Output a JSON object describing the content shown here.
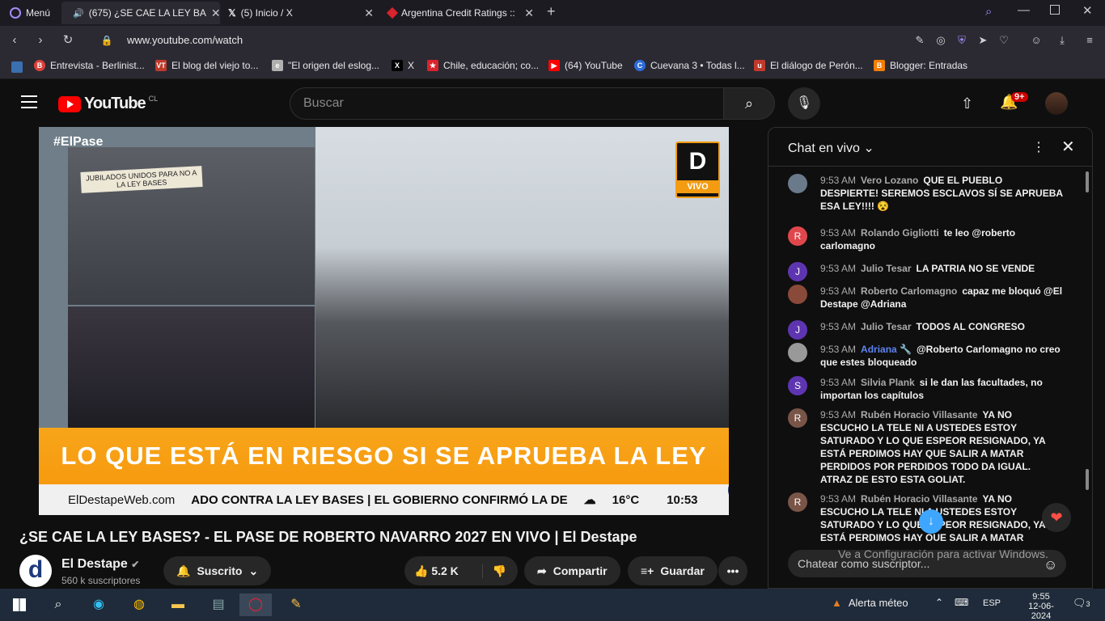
{
  "browser": {
    "menu_label": "Menú",
    "tabs": [
      {
        "title": "(675) ¿SE CAE LA LEY BA",
        "active": true
      },
      {
        "title": "(5) Inicio / X",
        "active": false
      },
      {
        "title": "Argentina Credit Ratings ::",
        "active": false
      }
    ],
    "url": "www.youtube.com/watch",
    "bookmarks": [
      {
        "label": "Entrevista - Berlinist...",
        "icon": "B",
        "color": "#d9413b"
      },
      {
        "label": "El blog del viejo to...",
        "icon": "VT",
        "color": "#c0392b"
      },
      {
        "label": "\"El origen del eslog...",
        "icon": "e",
        "color": "#b0b0b0"
      },
      {
        "label": "X",
        "icon": "X",
        "color": "#000000"
      },
      {
        "label": "Chile, educación; co...",
        "icon": "★",
        "color": "#d9232d"
      },
      {
        "label": "(64) YouTube",
        "icon": "▶",
        "color": "#ff0000"
      },
      {
        "label": "Cuevana 3 • Todas l...",
        "icon": "C",
        "color": "#2d6bd8"
      },
      {
        "label": "El diálogo de Perón...",
        "icon": "u",
        "color": "#c0392b"
      },
      {
        "label": "Blogger: Entradas",
        "icon": "B",
        "color": "#f57d00"
      }
    ]
  },
  "youtube": {
    "logo_text": "YouTube",
    "country": "CL",
    "search_placeholder": "Buscar",
    "notif_count": "9+"
  },
  "video": {
    "overlay_brand": "#ElPase",
    "sign_text": "JUBILADOS UNIDOS PARA NO A LA LEY BASES",
    "live_logo": "D",
    "live_label": "VIVO",
    "banner_text": "LO QUE ESTÁ EN RIESGO SI SE APRUEBA LA LEY",
    "ticker_site": "ElDestapeWeb.com",
    "ticker_text": "ADO CONTRA LA LEY BASES  |  EL GOBIERNO CONFIRMÓ LA DE",
    "temp": "16°C",
    "time": "10:53",
    "title": "¿SE CAE LA LEY BASES? - EL PASE DE ROBERTO NAVARRO 2027 EN VIVO | El Destape"
  },
  "channel": {
    "name": "El Destape",
    "subs": "560 k suscriptores",
    "subscribed_label": "Suscrito",
    "likes": "5.2 K",
    "share_label": "Compartir",
    "save_label": "Guardar"
  },
  "chat": {
    "title": "Chat en vivo",
    "messages": [
      {
        "time": "9:53 AM",
        "author": "Vero Lozano",
        "text": "QUE EL PUEBLO DESPIERTE! SEREMOS ESCLAVOS SÍ SE APRUEBA ESA LEY!!!! 😵",
        "avatar": "",
        "color": "#6b7a8a"
      },
      {
        "time": "9:53 AM",
        "author": "Rolando Gigliotti",
        "text": "te leo @roberto carlomagno",
        "avatar": "R",
        "color": "#e0474c"
      },
      {
        "time": "9:53 AM",
        "author": "Julio Tesar",
        "text": "LA PATRIA NO SE VENDE",
        "avatar": "J",
        "color": "#5e35b1"
      },
      {
        "time": "9:53 AM",
        "author": "Roberto Carlomagno",
        "text": "capaz me bloquó @El Destape @Adriana",
        "avatar": "",
        "color": "#8a4a3a"
      },
      {
        "time": "9:53 AM",
        "author": "Julio Tesar",
        "text": "TODOS AL CONGRESO",
        "avatar": "J",
        "color": "#5e35b1"
      },
      {
        "time": "9:53 AM",
        "author": "Adriana 🔧",
        "text": "@Roberto Carlomagno no creo que estes bloqueado",
        "avatar": "",
        "color": "#999999"
      },
      {
        "time": "9:53 AM",
        "author": "Silvia Plank",
        "text": "si le dan las facultades, no importan los capítulos",
        "avatar": "S",
        "color": "#5e35b1"
      },
      {
        "time": "9:53 AM",
        "author": "Rubén Horacio Villasante",
        "text": "YA NO ESCUCHO LA TELE NI A USTEDES ESTOY SATURADO Y LO QUE ESPEOR RESIGNADO, YA ESTÁ PERDIMOS HAY QUE SALIR A MATAR PERDIDOS POR PERDIDOS TODO DA IGUAL. ATRAZ DE ESTO ESTA GOLIAT.",
        "avatar": "R",
        "color": "#795548"
      },
      {
        "time": "9:53 AM",
        "author": "Rubén Horacio Villasante",
        "text": "YA NO ESCUCHO LA TELE NI A USTEDES ESTOY SATURADO Y LO QUE ESPEOR RESIGNADO, YA ESTÁ PERDIMOS HAY QUE SALIR A MATAR",
        "avatar": "R",
        "color": "#795548"
      }
    ],
    "input_placeholder": "Chatear como suscriptor..."
  },
  "windows": {
    "watermark": "Ve a Configuración para activar Windows.",
    "weather": "Alerta méteo",
    "lang": "ESP",
    "clock_time": "9:55",
    "clock_date": "12-06-2024",
    "notif": "3"
  }
}
